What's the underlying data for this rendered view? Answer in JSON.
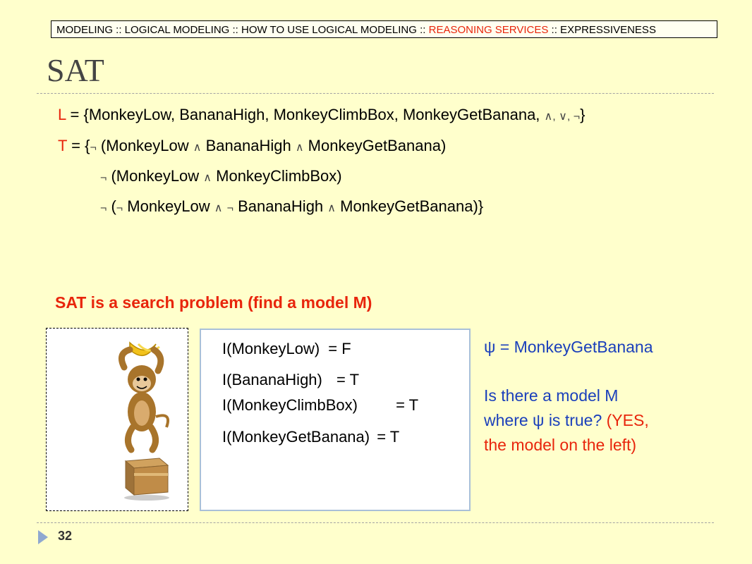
{
  "breadcrumb": {
    "part1": "MODELING :: LOGICAL MODELING :: HOW TO USE LOGICAL MODELING :: ",
    "highlight": "REASONING SERVICES",
    "part2": " :: EXPRESSIVENESS"
  },
  "title": "SAT",
  "language": {
    "label": "L",
    "eq": " = {",
    "items": "MonkeyLow, BananaHigh, MonkeyClimbBox, MonkeyGetBanana, ",
    "ops": "∧, ∨, ¬",
    "close": "}"
  },
  "theory": {
    "label": "T",
    "eq": " = {",
    "rows": [
      {
        "neg": "¬",
        "text": " (MonkeyLow ",
        "and1": "∧",
        "text2": " BananaHigh ",
        "and2": "∧",
        "text3": " MonkeyGetBanana)"
      },
      {
        "neg": "¬",
        "text": " (MonkeyLow ",
        "and1": "∧",
        "text2": " MonkeyClimbBox)"
      },
      {
        "neg": "¬",
        "text": " (",
        "neg2": "¬",
        "text2": " MonkeyLow ",
        "and1": "∧",
        "text3": " ",
        "neg3": "¬",
        "text4": " BananaHigh ",
        "and2": "∧",
        "text5": " MonkeyGetBanana)}"
      }
    ]
  },
  "search_heading": "SAT is a search problem (find a model M)",
  "model": [
    {
      "name": "I(MonkeyLow)",
      "value": "= F"
    },
    {
      "name": "I(BananaHigh)",
      "value": "= T"
    },
    {
      "name": "I(MonkeyClimbBox)",
      "value": "= T"
    },
    {
      "name": "I(MonkeyGetBanana)",
      "value": "= T"
    }
  ],
  "query": {
    "psi": "ψ = MonkeyGetBanana",
    "q1": "Is there a model M",
    "q2": "where ψ is true? ",
    "a1": "(YES,",
    "a2": "the model on the left)"
  },
  "page_number": "32"
}
